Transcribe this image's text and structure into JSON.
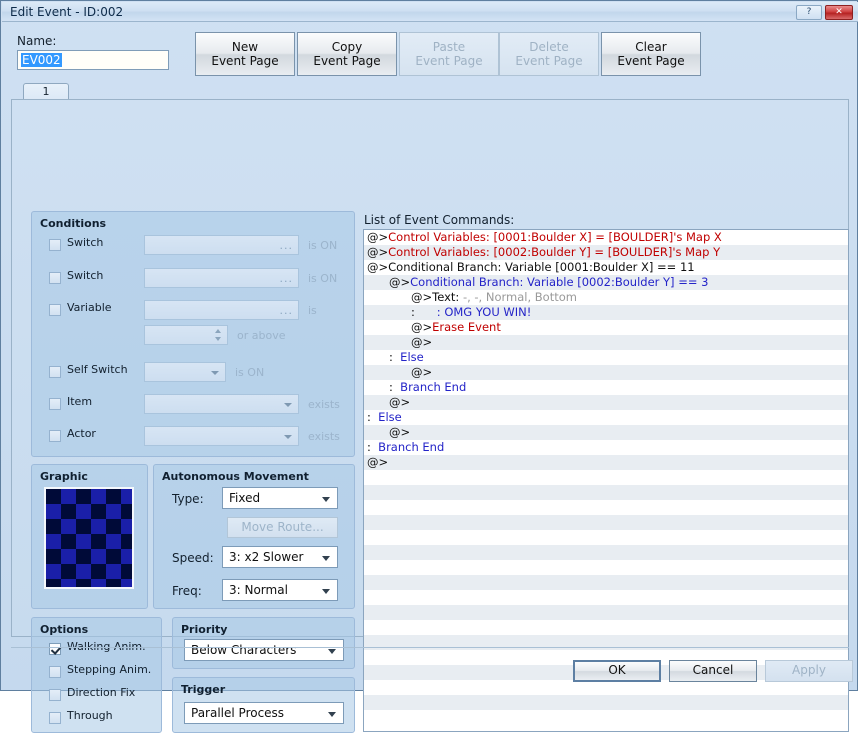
{
  "window": {
    "title": "Edit Event - ID:002",
    "help_button": "?",
    "close_button": "✕"
  },
  "name_section": {
    "label": "Name:",
    "value": "EV002"
  },
  "page_buttons": [
    {
      "label": "New\nEvent Page",
      "enabled": true
    },
    {
      "label": "Copy\nEvent Page",
      "enabled": true
    },
    {
      "label": "Paste\nEvent Page",
      "enabled": false
    },
    {
      "label": "Delete\nEvent Page",
      "enabled": false
    },
    {
      "label": "Clear\nEvent Page",
      "enabled": true
    }
  ],
  "tabs": [
    {
      "label": "1",
      "selected": true
    }
  ],
  "conditions": {
    "title": "Conditions",
    "rows": [
      {
        "name": "Switch",
        "checked": false,
        "value": "",
        "browse": "...",
        "suffix": "is ON"
      },
      {
        "name": "Switch",
        "checked": false,
        "value": "",
        "browse": "...",
        "suffix": "is ON"
      },
      {
        "name": "Variable",
        "checked": false,
        "value": "",
        "browse": "...",
        "suffix": "is"
      },
      {
        "name": "",
        "checked": null,
        "value": "",
        "browse": "",
        "suffix": "or above"
      },
      {
        "name": "Self Switch",
        "checked": false,
        "value": "",
        "browse": "",
        "suffix": "is ON"
      },
      {
        "name": "Item",
        "checked": false,
        "value": "",
        "browse": "",
        "suffix": "exists"
      },
      {
        "name": "Actor",
        "checked": false,
        "value": "",
        "browse": "",
        "suffix": "exists"
      }
    ]
  },
  "graphic": {
    "title": "Graphic"
  },
  "autonomous_movement": {
    "title": "Autonomous Movement",
    "type_label": "Type:",
    "type_value": "Fixed",
    "move_route_button": "Move Route...",
    "speed_label": "Speed:",
    "speed_value": "3: x2 Slower",
    "freq_label": "Freq:",
    "freq_value": "3: Normal"
  },
  "options": {
    "title": "Options",
    "items": [
      {
        "label": "Walking Anim.",
        "checked": true
      },
      {
        "label": "Stepping Anim.",
        "checked": false
      },
      {
        "label": "Direction Fix",
        "checked": false
      },
      {
        "label": "Through",
        "checked": false
      }
    ]
  },
  "priority": {
    "title": "Priority",
    "value": "Below Characters"
  },
  "trigger": {
    "title": "Trigger",
    "value": "Parallel Process"
  },
  "event_commands": {
    "label": "List of Event Commands:",
    "rows": [
      {
        "indent": 0,
        "prefix": "@>",
        "prefix_color": "dark",
        "text": "Control Variables: [0001:Boulder X] = [BOULDER]'s Map X",
        "color": "red",
        "suffix": "",
        "suffix_color": "gray"
      },
      {
        "indent": 0,
        "prefix": "@>",
        "prefix_color": "dark",
        "text": "Control Variables: [0002:Boulder Y] = [BOULDER]'s Map Y",
        "color": "red",
        "suffix": "",
        "suffix_color": "gray"
      },
      {
        "indent": 0,
        "prefix": "@>",
        "prefix_color": "dark",
        "text": "Conditional Branch: Variable [0001:Boulder X] == 11",
        "color": "dark",
        "suffix": "",
        "suffix_color": "gray"
      },
      {
        "indent": 1,
        "prefix": "@>",
        "prefix_color": "dark",
        "text": "Conditional Branch: Variable [0002:Boulder Y] == 3",
        "color": "blue",
        "suffix": "",
        "suffix_color": "gray"
      },
      {
        "indent": 2,
        "prefix": "@>",
        "prefix_color": "dark",
        "text": "Text: ",
        "color": "dark",
        "suffix": "-, -, Normal, Bottom",
        "suffix_color": "gray"
      },
      {
        "indent": 2,
        "prefix": ":",
        "prefix_color": "dark",
        "text": "      : OMG YOU WIN!",
        "color": "blue",
        "suffix": "",
        "suffix_color": "gray"
      },
      {
        "indent": 2,
        "prefix": "@>",
        "prefix_color": "dark",
        "text": "Erase Event",
        "color": "red",
        "suffix": "",
        "suffix_color": "gray"
      },
      {
        "indent": 2,
        "prefix": "@>",
        "prefix_color": "dark",
        "text": "",
        "color": "dark",
        "suffix": "",
        "suffix_color": "gray"
      },
      {
        "indent": 1,
        "prefix": ":",
        "prefix_color": "dark",
        "text": "  Else",
        "color": "blue",
        "suffix": "",
        "suffix_color": "gray"
      },
      {
        "indent": 2,
        "prefix": "@>",
        "prefix_color": "dark",
        "text": "",
        "color": "dark",
        "suffix": "",
        "suffix_color": "gray"
      },
      {
        "indent": 1,
        "prefix": ":",
        "prefix_color": "dark",
        "text": "  Branch End",
        "color": "blue",
        "suffix": "",
        "suffix_color": "gray"
      },
      {
        "indent": 1,
        "prefix": "@>",
        "prefix_color": "dark",
        "text": "",
        "color": "dark",
        "suffix": "",
        "suffix_color": "gray"
      },
      {
        "indent": 0,
        "prefix": ":",
        "prefix_color": "dark",
        "text": "  Else",
        "color": "blue",
        "suffix": "",
        "suffix_color": "gray"
      },
      {
        "indent": 1,
        "prefix": "@>",
        "prefix_color": "dark",
        "text": "",
        "color": "dark",
        "suffix": "",
        "suffix_color": "gray"
      },
      {
        "indent": 0,
        "prefix": ":",
        "prefix_color": "dark",
        "text": "  Branch End",
        "color": "blue",
        "suffix": "",
        "suffix_color": "gray"
      },
      {
        "indent": 0,
        "prefix": "@>",
        "prefix_color": "dark",
        "text": "",
        "color": "dark",
        "suffix": "",
        "suffix_color": "gray"
      }
    ]
  },
  "dialog_buttons": [
    {
      "label": "OK",
      "enabled": true,
      "default": true
    },
    {
      "label": "Cancel",
      "enabled": true,
      "default": false
    },
    {
      "label": "Apply",
      "enabled": false,
      "default": false
    }
  ],
  "colors": {
    "command_red": "#c00000",
    "command_blue": "#2424c8",
    "command_gray": "#9a9a9a",
    "selection_blue": "#3399ff",
    "panel_blue": "#cfe0f2"
  }
}
